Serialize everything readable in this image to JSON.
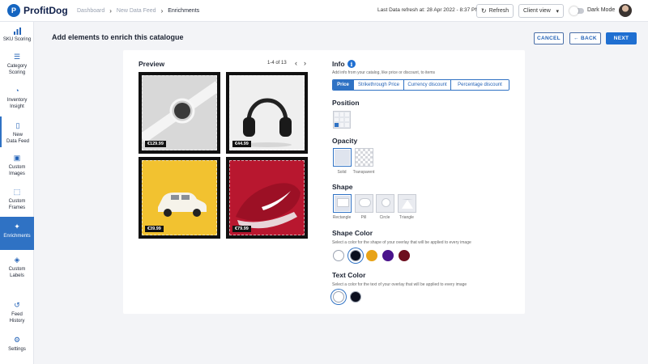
{
  "app": {
    "name": "ProfitDog",
    "logo_letter": "P"
  },
  "breadcrumb": [
    "Dashboard",
    "New Data Feed",
    "Enrichments"
  ],
  "header": {
    "refresh_text": "Last Data refresh at: 28 Apr 2022 - 8:37 PM",
    "refresh_label": "Refresh",
    "client_view": "Client view",
    "dark_mode_label": "Dark Mode"
  },
  "sidebar": {
    "items": [
      {
        "label_1": "SKU Scoring",
        "label_2": ""
      },
      {
        "label_1": "Category",
        "label_2": "Scoring"
      },
      {
        "label_1": "Inventory",
        "label_2": "Insight"
      },
      {
        "label_1": "New",
        "label_2": "Data Feed"
      },
      {
        "label_1": "Custom",
        "label_2": "Images"
      },
      {
        "label_1": "Custom",
        "label_2": "Frames"
      },
      {
        "label_1": "Enrichments",
        "label_2": ""
      },
      {
        "label_1": "Custom",
        "label_2": "Labels"
      },
      {
        "label_1": "Feed",
        "label_2": "History"
      },
      {
        "label_1": "Settings",
        "label_2": ""
      }
    ]
  },
  "page": {
    "title": "Add elements to enrich this catalogue",
    "cancel": "CANCEL",
    "back": "BACK",
    "next": "NEXT"
  },
  "preview": {
    "title": "Preview",
    "pager": "1-4 of 13",
    "products": [
      {
        "price": "€129.99"
      },
      {
        "price": "€44.99"
      },
      {
        "price": "€39.99"
      },
      {
        "price": "€79.99"
      }
    ]
  },
  "info": {
    "title": "Info",
    "hint": "Add info from your catalog, like price or discount, to items",
    "tabs": [
      "Price",
      "Strikethrough Price",
      "Currency discount",
      "Percentage discount"
    ],
    "active_tab": "Price"
  },
  "position": {
    "title": "Position"
  },
  "opacity": {
    "title": "Opacity",
    "options": [
      "Solid",
      "Transparent"
    ]
  },
  "shape": {
    "title": "Shape",
    "options": [
      "Rectangle",
      "Pill",
      "Circle",
      "Triangle"
    ]
  },
  "shape_color": {
    "title": "Shape Color",
    "hint": "Select a color for the shape of your overlay that will be applied to every image",
    "swatches": [
      "#ffffff",
      "#0b0f1e",
      "#e8a317",
      "#4a148c",
      "#6d0f1f"
    ]
  },
  "text_color": {
    "title": "Text Color",
    "hint": "Select a color for the text of your overlay that will be applied to every image",
    "swatches": [
      "#ffffff",
      "#0b0f1e"
    ]
  },
  "colors": {
    "accent": "#1f6fd1"
  }
}
